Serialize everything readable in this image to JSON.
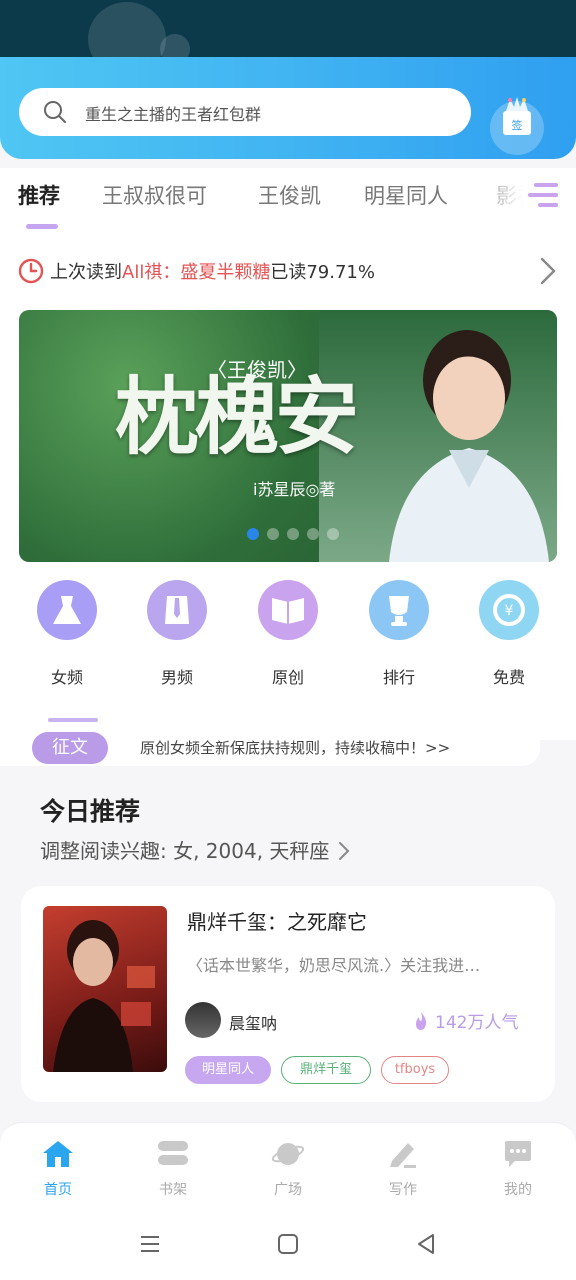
{
  "search": {
    "placeholder": "重生之主播的王者红包群"
  },
  "signin": {
    "label": "签"
  },
  "tabs": [
    {
      "label": "推荐",
      "active": true
    },
    {
      "label": "王叔叔很可"
    },
    {
      "label": "王俊凯"
    },
    {
      "label": "明星同人"
    },
    {
      "label": "影视"
    }
  ],
  "last_read": {
    "prefix": "上次读到",
    "book": "All祺：盛夏半颗糖",
    "suffix": "已读79.71%"
  },
  "banner": {
    "subtitle": "〈王俊凯〉",
    "title": "枕槐安",
    "author": "i苏星辰◎著",
    "page_index": 0,
    "page_count": 5
  },
  "categories": [
    {
      "label": "女频",
      "icon": "dress-icon",
      "color": "#a99ef5"
    },
    {
      "label": "男频",
      "icon": "shirt-icon",
      "color": "#b9a6ef"
    },
    {
      "label": "原创",
      "icon": "book-icon",
      "color": "#c9a3ee"
    },
    {
      "label": "排行",
      "icon": "trophy-icon",
      "color": "#8cc6f5"
    },
    {
      "label": "免费",
      "icon": "coin-icon",
      "color": "#8fd6f3"
    }
  ],
  "notice": {
    "badge": "征文",
    "text": "原创女频全新保底扶持规则，持续收稿中！>>"
  },
  "today": {
    "title": "今日推荐",
    "subtitle": "调整阅读兴趣: 女, 2004, 天秤座"
  },
  "book_card": {
    "title": "鼎烊千玺：之死靡它",
    "description": "〈话本世繁华，奶思尽风流.〉关注我进…",
    "author": "晨玺呐",
    "popularity": "142万人气",
    "tags": [
      "明星同人",
      "鼎烊千玺",
      "tfboys"
    ]
  },
  "bottom_nav": [
    {
      "label": "首页",
      "active": true
    },
    {
      "label": "书架"
    },
    {
      "label": "广场"
    },
    {
      "label": "写作"
    },
    {
      "label": "我的"
    }
  ],
  "colors": {
    "accent": "#2aa6ef",
    "purple": "#b99be8",
    "red": "#e45454"
  }
}
